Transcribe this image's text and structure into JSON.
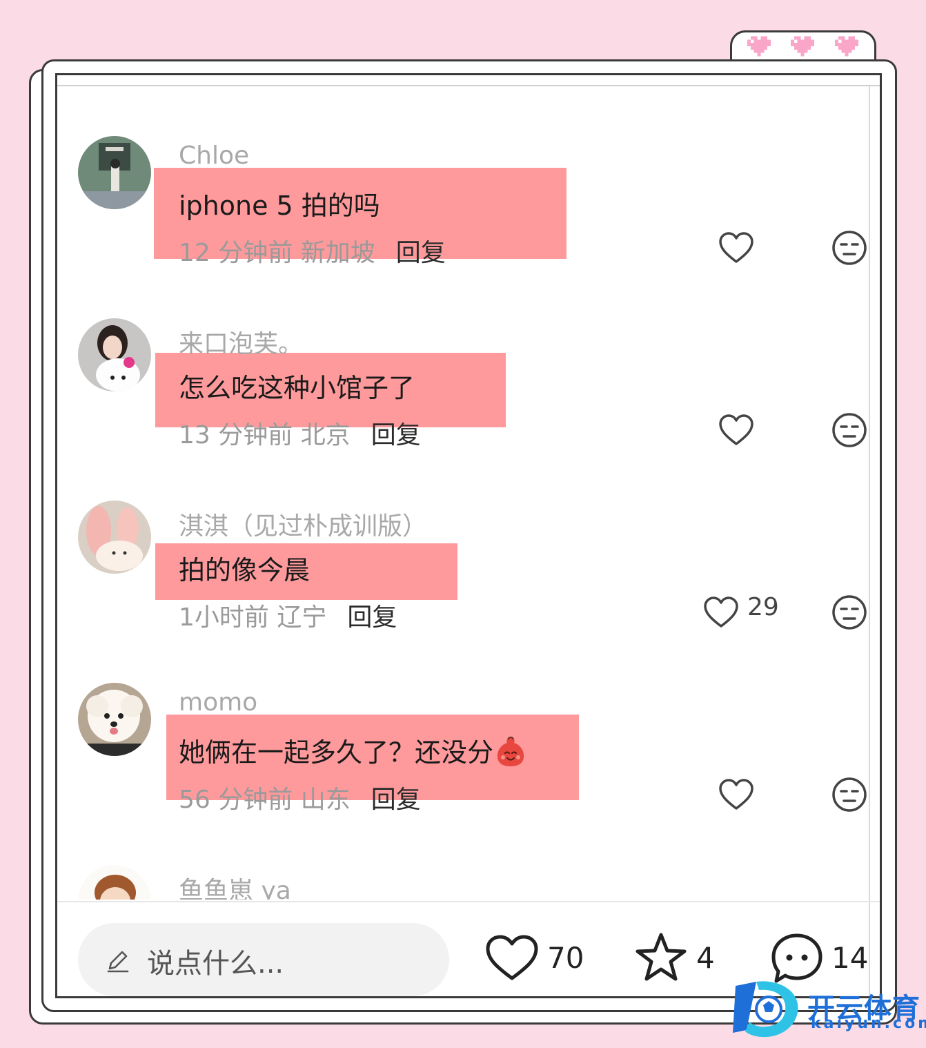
{
  "comments": [
    {
      "username": "Chloe",
      "text": "iphone 5 拍的吗",
      "time": "12 分钟前",
      "location": "新加坡",
      "reply": "回复",
      "likes": ""
    },
    {
      "username": "来口泡芙。",
      "text": "怎么吃这种小馆子了",
      "time": "13 分钟前",
      "location": "北京",
      "reply": "回复",
      "likes": ""
    },
    {
      "username": "淇淇（见过朴成训版）",
      "text": "拍的像今晨",
      "time": "1小时前",
      "location": "辽宁",
      "reply": "回复",
      "likes": "29"
    },
    {
      "username": "momo",
      "text": "她俩在一起多久了？还没分",
      "time": "56 分钟前",
      "location": "山东",
      "reply": "回复",
      "likes": ""
    },
    {
      "username": "鱼鱼崽 ya"
    }
  ],
  "bottom_bar": {
    "input_placeholder": "说点什么...",
    "likes": "70",
    "favorites": "4",
    "comments": "14"
  },
  "watermark": {
    "name": "开云体育",
    "domain": "kaiyun.com"
  },
  "colors": {
    "background": "#fbdbe6",
    "highlight": "#fe9a9c",
    "watermark": "#1e6fd8"
  }
}
